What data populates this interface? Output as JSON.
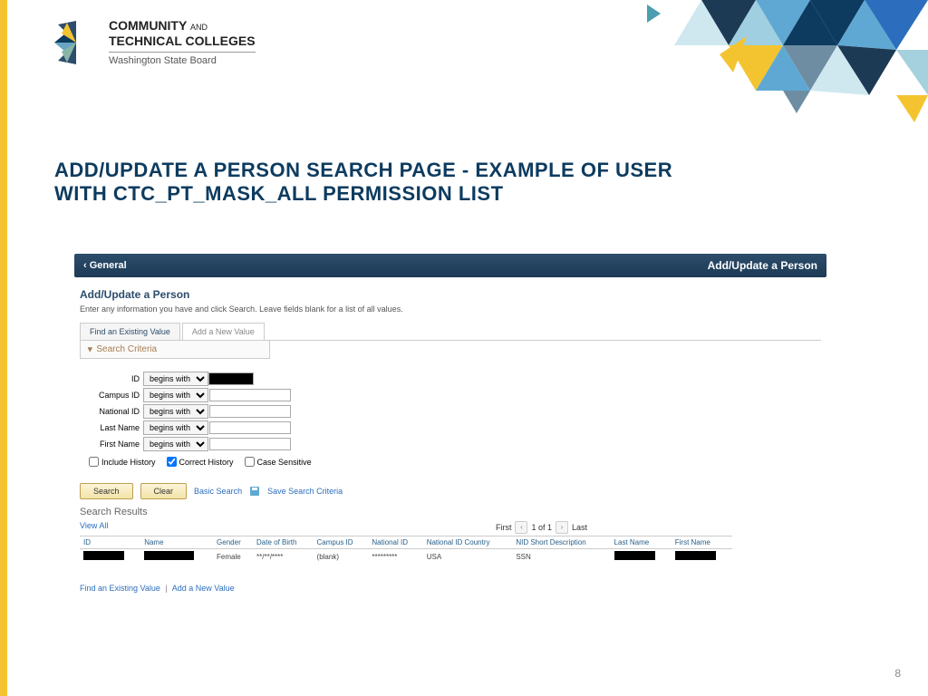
{
  "logo": {
    "line1": "COMMUNITY",
    "line1_and": "AND",
    "line2": "TECHNICAL COLLEGES",
    "sub": "Washington State Board"
  },
  "heading": "ADD/UPDATE A PERSON SEARCH PAGE - EXAMPLE OF USER WITH CTC_PT_MASK_ALL PERMISSION LIST",
  "ps": {
    "back_label": "General",
    "header_title": "Add/Update a Person",
    "section_title": "Add/Update a Person",
    "instructions": "Enter any information you have and click Search. Leave fields blank for a list of all values.",
    "tab1": "Find an Existing Value",
    "tab2": "Add a New Value",
    "search_criteria_label": "Search Criteria",
    "fields": {
      "id": "ID",
      "campus_id": "Campus ID",
      "national_id": "National ID",
      "last_name": "Last Name",
      "first_name": "First Name",
      "op": "begins with"
    },
    "checks": {
      "include_history": "Include History",
      "correct_history": "Correct History",
      "case_sensitive": "Case Sensitive"
    },
    "buttons": {
      "search": "Search",
      "clear": "Clear",
      "basic_search": "Basic Search",
      "save_criteria": "Save Search Criteria"
    },
    "results": {
      "title": "Search Results",
      "view_all": "View All",
      "first": "First",
      "count": "1 of 1",
      "last": "Last",
      "columns": [
        "ID",
        "Name",
        "Gender",
        "Date of Birth",
        "Campus ID",
        "National ID",
        "National ID Country",
        "NID Short Description",
        "Last Name",
        "First Name"
      ],
      "row": {
        "gender": "Female",
        "dob": "**/**/****",
        "campus_id": "(blank)",
        "national_id": "*********",
        "country": "USA",
        "nid_desc": "SSN"
      }
    },
    "bottom_link1": "Find an Existing Value",
    "bottom_link2": "Add a New Value"
  },
  "page_number": "8"
}
